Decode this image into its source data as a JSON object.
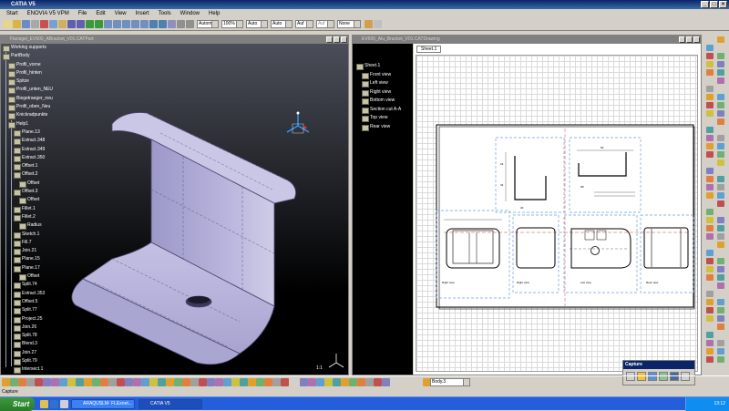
{
  "app": {
    "title": "CATIA V5",
    "menus": [
      "Start",
      "ENOVIA V5 VPM",
      "File",
      "Edit",
      "View",
      "Insert",
      "Tools",
      "Window",
      "Help"
    ]
  },
  "toolbar": {
    "combos": [
      "Automa",
      "100%",
      "Auto",
      "Auto",
      "Auf",
      "Auf",
      "None"
    ]
  },
  "part_window": {
    "title": "Flansgel_EV600_ABracket_V01.CATPart",
    "tree": [
      "Working supports",
      "PartBody",
      "Profil_vorne",
      "Profil_hinten",
      "Spitze",
      "Profil_unten_NEU",
      "Biegetraeger_neu",
      "Profil_oben_Neu",
      "Knickradpunkte",
      "Help1",
      "Plane.13",
      "Extract.348",
      "Extract.349",
      "Extract.350",
      "Offset.1",
      "Offset.2",
      "Offset",
      "Offset.3",
      "Offset",
      "Fillet.1",
      "Fillet.2",
      "Radius",
      "Sketch.1",
      "Fill.7",
      "Join.21",
      "Plane.15",
      "Plane.17",
      "Offset",
      "Split.74",
      "Extract.353",
      "Offset.5",
      "Split.77",
      "Project.25",
      "Join.26",
      "Split.78",
      "Blend.3",
      "Join.27",
      "Split.79",
      "Intersect.1"
    ],
    "scale": "1:1"
  },
  "drawing_window": {
    "title": "EV600_Alu_Bracket_V01.CATDrawing",
    "tree": [
      "Sheet.1",
      "Front view",
      "Left view",
      "Right view",
      "Bottom view",
      "Section cut A-A",
      "Top view",
      "Rear view"
    ],
    "sheet_tab": "Sheet.1",
    "view_labels": [
      "Section cut A-A",
      "Front view\nScale: 1:1",
      "Right view\nScale: 1:1",
      "Left view\nScale: 1:1",
      "Bottom view\nScale: 1:1",
      "Rear view\nScale: 1:1"
    ]
  },
  "bottom_toolbar": {
    "body_combo": "Body.3"
  },
  "status": {
    "text": "Capture"
  },
  "capture_panel": {
    "title": "Capture"
  },
  "taskbar": {
    "start": "Start",
    "tasks": [
      "ARAQUSLM- FLExnet...",
      "CATIA V5"
    ],
    "clock": "13:12"
  },
  "colors": {
    "accent": "#0a246a",
    "part_surface": "#bcb8dd",
    "viewport_top": "#4b4e59",
    "taskbar": "#245edb"
  }
}
